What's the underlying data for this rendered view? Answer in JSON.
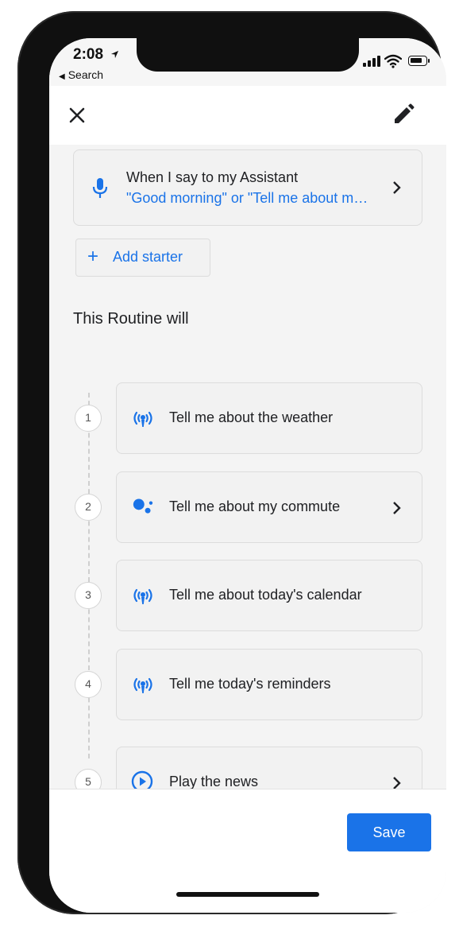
{
  "status_bar": {
    "time": "2:08",
    "back_label": "Search"
  },
  "header": {
    "close_icon": "close-icon",
    "edit_icon": "pencil-icon"
  },
  "starter": {
    "title": "When I say to my Assistant",
    "subtitle": "\"Good morning\" or \"Tell me about my day\"",
    "icon": "microphone-icon"
  },
  "add_starter": {
    "label": "Add starter"
  },
  "routine": {
    "section_title": "This Routine will",
    "steps": [
      {
        "number": "1",
        "label": "Tell me about the weather",
        "icon": "broadcast-icon",
        "has_chevron": false
      },
      {
        "number": "2",
        "label": "Tell me about my commute",
        "icon": "google-assistant-icon",
        "has_chevron": true
      },
      {
        "number": "3",
        "label": "Tell me about today's calendar",
        "icon": "broadcast-icon",
        "has_chevron": false
      },
      {
        "number": "4",
        "label": "Tell me today's reminders",
        "icon": "broadcast-icon",
        "has_chevron": false
      },
      {
        "number": "5",
        "label": "Play the news",
        "icon": "play-circle-icon",
        "has_chevron": true
      }
    ]
  },
  "footer": {
    "save_label": "Save"
  },
  "colors": {
    "accent": "#1a73e8",
    "background": "#f4f4f4",
    "card": "#f2f2f2"
  }
}
